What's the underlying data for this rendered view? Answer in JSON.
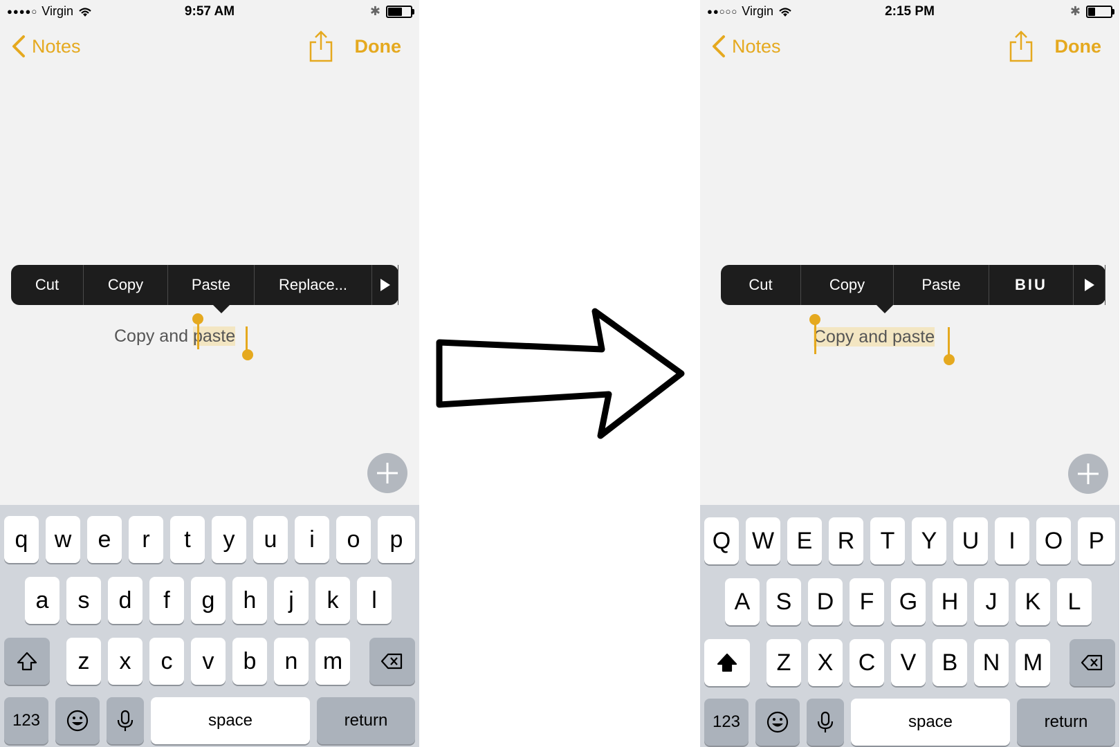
{
  "left": {
    "status": {
      "carrier": "Virgin",
      "dots": "●●●●○",
      "time": "9:57 AM",
      "battery_level": 0.6
    },
    "nav": {
      "back_label": "Notes",
      "done_label": "Done"
    },
    "menu": {
      "items": [
        "Cut",
        "Copy",
        "Paste",
        "Replace..."
      ]
    },
    "note": {
      "unselected": "Copy and ",
      "selected": "paste"
    },
    "keyboard": {
      "row1": [
        "q",
        "w",
        "e",
        "r",
        "t",
        "y",
        "u",
        "i",
        "o",
        "p"
      ],
      "row2": [
        "a",
        "s",
        "d",
        "f",
        "g",
        "h",
        "j",
        "k",
        "l"
      ],
      "row3": [
        "z",
        "x",
        "c",
        "v",
        "b",
        "n",
        "m"
      ],
      "numbers_label": "123",
      "space_label": "space",
      "return_label": "return"
    }
  },
  "right": {
    "status": {
      "carrier": "Virgin",
      "dots": "●●○○○",
      "time": "2:15 PM",
      "battery_level": 0.3
    },
    "nav": {
      "back_label": "Notes",
      "done_label": "Done"
    },
    "menu": {
      "items": [
        "Cut",
        "Copy",
        "Paste",
        "BIU"
      ]
    },
    "note": {
      "unselected": "",
      "selected": "Copy and paste"
    },
    "keyboard": {
      "row1": [
        "Q",
        "W",
        "E",
        "R",
        "T",
        "Y",
        "U",
        "I",
        "O",
        "P"
      ],
      "row2": [
        "A",
        "S",
        "D",
        "F",
        "G",
        "H",
        "J",
        "K",
        "L"
      ],
      "row3": [
        "Z",
        "X",
        "C",
        "V",
        "B",
        "N",
        "M"
      ],
      "numbers_label": "123",
      "space_label": "space",
      "return_label": "return"
    }
  },
  "colors": {
    "accent": "#e5a91f",
    "menu_bg": "#1d1d1d",
    "keyboard_bg": "#d1d5db",
    "selection": "#f3e6c2"
  },
  "icons": [
    "back-chevron-icon",
    "share-icon",
    "wifi-icon",
    "bluetooth-icon",
    "battery-icon",
    "more-arrow-icon",
    "plus-icon",
    "shift-icon",
    "delete-icon",
    "emoji-icon",
    "mic-icon",
    "right-arrow-icon"
  ]
}
